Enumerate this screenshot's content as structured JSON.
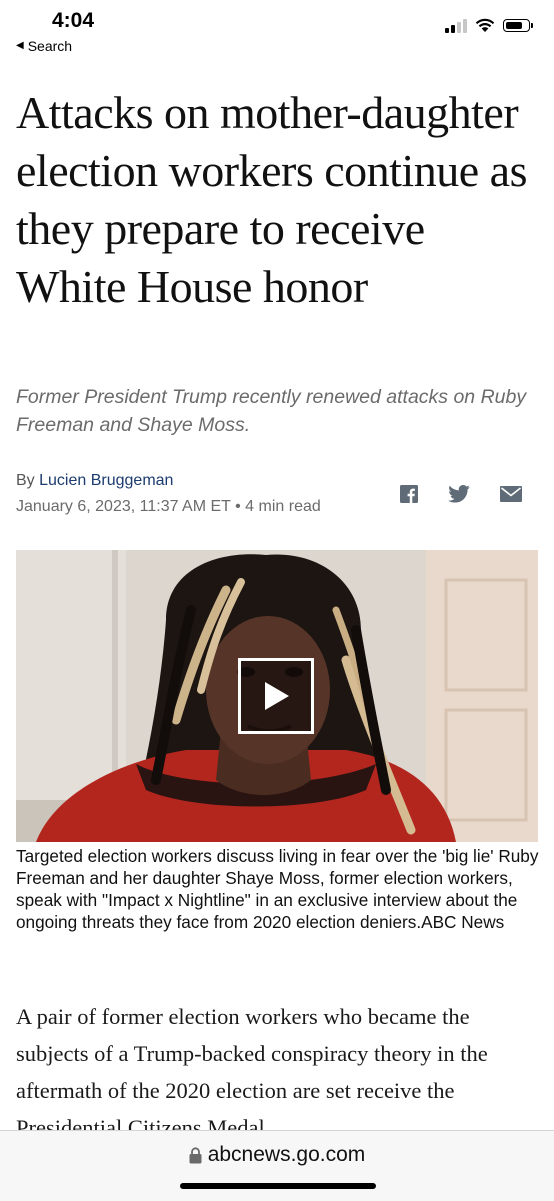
{
  "status_bar": {
    "time": "4:04",
    "back_label": "Search"
  },
  "article": {
    "headline": "Attacks on mother-daughter election workers continue as they prepare to receive White House honor",
    "subhead": "Former President Trump recently renewed attacks on Ruby Freeman and Shaye Moss.",
    "byline_prefix": "By",
    "author": "Lucien Bruggeman",
    "date": "January 6, 2023, 11:37 AM ET",
    "separator": "•",
    "read_time": "4 min read",
    "share_icons": [
      "facebook-icon",
      "twitter-icon",
      "mail-icon"
    ],
    "video_caption": "Targeted election workers discuss living in fear over the 'big lie' Ruby Freeman and her daughter Shaye Moss, former election workers, speak with \"Impact x Nightline\" in an exclusive interview about the ongoing threats they face from 2020 election deniers.ABC News",
    "body_paragraph": "A pair of former election workers who became the subjects of a Trump-backed conspiracy theory in the aftermath of the 2020 election are set receive the Presidential Citizens Medal"
  },
  "browser": {
    "url": "abcnews.go.com"
  },
  "colors": {
    "author_link": "#1c3b6e",
    "subhead": "#6b6b6b",
    "dress_red": "#b3261e"
  }
}
